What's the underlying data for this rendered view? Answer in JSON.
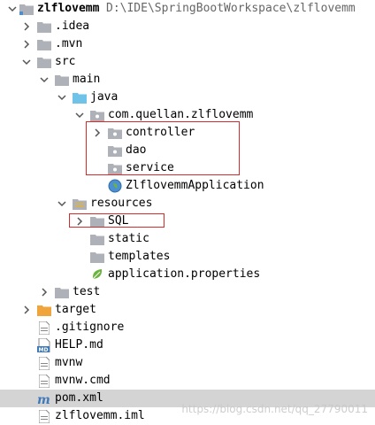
{
  "project": {
    "name": "zlflovemm",
    "path": "D:\\IDE\\SpringBootWorkspace\\zlflovemm"
  },
  "tree": {
    "idea": ".idea",
    "mvn": ".mvn",
    "src": "src",
    "main": "main",
    "java": "java",
    "package": "com.quellan.zlflovemm",
    "controller": "controller",
    "dao": "dao",
    "service": "service",
    "app_class": "ZlflovemmApplication",
    "resources": "resources",
    "sql": "SQL",
    "static": "static",
    "templates": "templates",
    "app_props": "application.properties",
    "test": "test",
    "target": "target",
    "gitignore": ".gitignore",
    "help": "HELP.md",
    "help_badge": "MD",
    "mvnw": "mvnw",
    "mvnw_cmd": "mvnw.cmd",
    "pom": "pom.xml",
    "iml": "zlflovemm.iml"
  },
  "watermark": "https://blog.csdn.net/qq_27790011",
  "colors": {
    "folder_gray": "#aeb2b8",
    "folder_blue": "#6fc2e8",
    "folder_orange": "#f0a53c",
    "spring_green": "#6db33f",
    "highlight_red": "#d82a2a",
    "selection": "#d4d4d4",
    "maven_blue": "#3f79b8"
  }
}
